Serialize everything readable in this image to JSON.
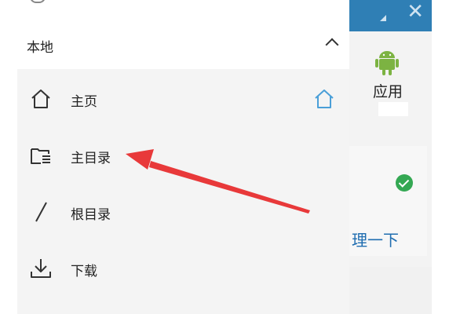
{
  "drawer": {
    "section_title": "本地",
    "items": [
      {
        "label": "主页",
        "icon": "home-icon"
      },
      {
        "label": "主目录",
        "icon": "folder-list-icon"
      },
      {
        "label": "根目录",
        "icon": "slash-icon"
      },
      {
        "label": "下载",
        "icon": "download-icon"
      }
    ]
  },
  "background_app": {
    "app_label": "应用",
    "partial_text": "理一下"
  },
  "colors": {
    "header_blue": "#2f7fb5",
    "accent_blue": "#4a9fd8",
    "arrow_red": "#e8393a",
    "check_green": "#34a853"
  }
}
